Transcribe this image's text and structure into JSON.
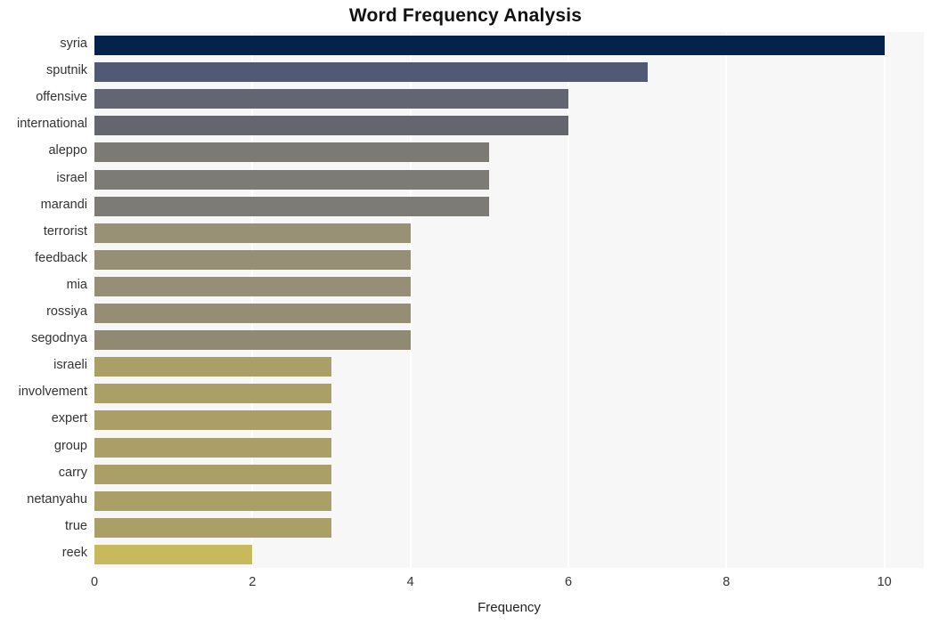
{
  "chart_data": {
    "type": "bar",
    "orientation": "horizontal",
    "title": "Word Frequency Analysis",
    "xlabel": "Frequency",
    "ylabel": "",
    "xlim": [
      0,
      10.5
    ],
    "xticks": [
      0,
      2,
      4,
      6,
      8,
      10
    ],
    "grid": "vertical-only",
    "legend": "none",
    "plot_background": "#f7f7f7",
    "gridline_color": "#ffffff",
    "categories": [
      "syria",
      "sputnik",
      "offensive",
      "international",
      "aleppo",
      "israel",
      "marandi",
      "terrorist",
      "feedback",
      "mia",
      "rossiya",
      "segodnya",
      "israeli",
      "involvement",
      "expert",
      "group",
      "carry",
      "netanyahu",
      "true",
      "reek"
    ],
    "values": [
      10,
      7,
      6,
      6,
      5,
      5,
      5,
      4,
      4,
      4,
      4,
      4,
      3,
      3,
      3,
      3,
      3,
      3,
      3,
      2
    ],
    "bar_colors": [
      "#04234b",
      "#515a74",
      "#636672",
      "#63666f",
      "#7c7a75",
      "#7d7b76",
      "#7d7b75",
      "#989176",
      "#968f75",
      "#968f75",
      "#958e74",
      "#918a72",
      "#ab9f68",
      "#ab9f68",
      "#ab9f68",
      "#ab9f68",
      "#ab9f68",
      "#ab9f68",
      "#ab9f68",
      "#c9b95d"
    ]
  }
}
